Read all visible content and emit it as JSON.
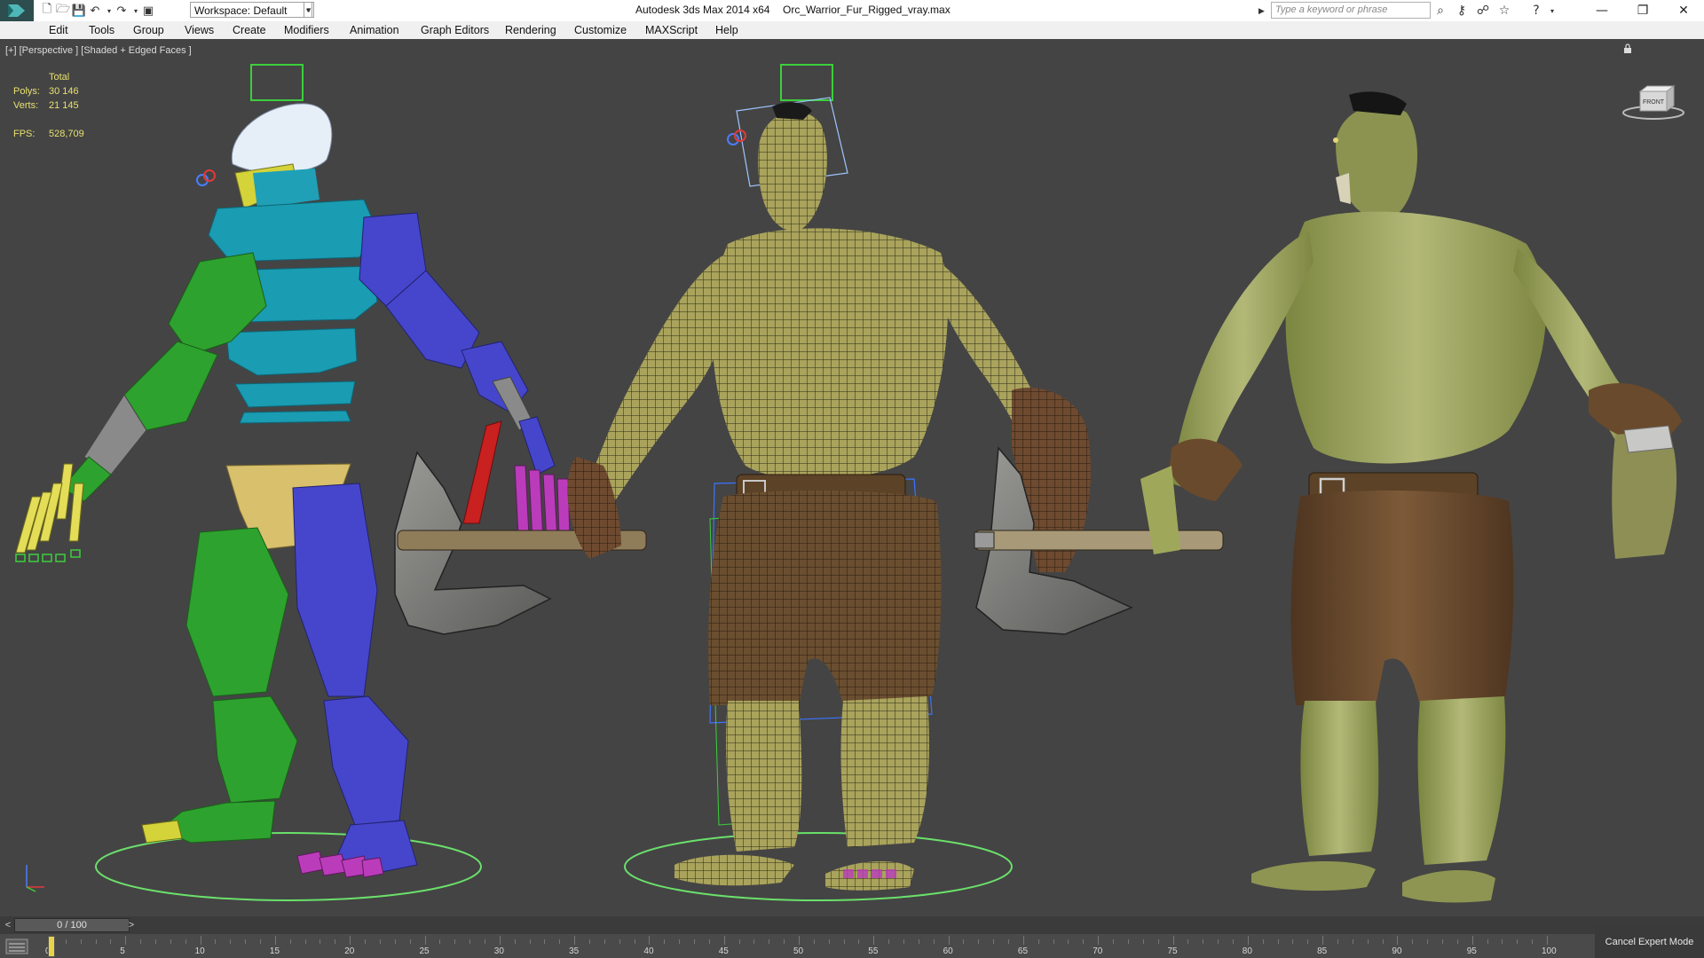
{
  "title_bar": {
    "app_name": "Autodesk 3ds Max  2014 x64",
    "file_name": "Orc_Warrior_Fur_Rigged_vray.max",
    "workspace": "Workspace: Default",
    "search_placeholder": "Type a keyword or phrase"
  },
  "menu": {
    "items": [
      "Edit",
      "Tools",
      "Group",
      "Views",
      "Create",
      "Modifiers",
      "Animation",
      "Graph Editors",
      "Rendering",
      "Customize",
      "MAXScript",
      "Help"
    ]
  },
  "viewport": {
    "label": "[+] [Perspective ] [Shaded + Edged Faces ]",
    "viewcube_label": "FRONT",
    "stats": {
      "total_label": "Total",
      "polys_label": "Polys:",
      "polys": "30 146",
      "verts_label": "Verts:",
      "verts": "21 145",
      "fps_label": "FPS:",
      "fps": "528,709"
    }
  },
  "timeline": {
    "frame_display": "0 / 100",
    "ticks": [
      "0",
      "5",
      "10",
      "15",
      "20",
      "25",
      "30",
      "35",
      "40",
      "45",
      "50",
      "55",
      "60",
      "65",
      "70",
      "75",
      "80",
      "85",
      "90",
      "95",
      "100"
    ]
  },
  "status": {
    "cancel_expert_mode": "Cancel Expert Mode"
  },
  "colors": {
    "viewport_bg": "#444444",
    "stats_text": "#e8e070",
    "rig_green": "#2ea22e",
    "rig_cyan": "#1f9fb3",
    "rig_blue": "#4444cc",
    "rig_magenta": "#b83cb8",
    "rig_yellow": "#d7d33a",
    "skin": "#9fa85a",
    "shorts": "#6a4a2c"
  },
  "scene": {
    "figures": [
      "rig-skeleton",
      "wireframe-orc",
      "shaded-orc"
    ]
  }
}
